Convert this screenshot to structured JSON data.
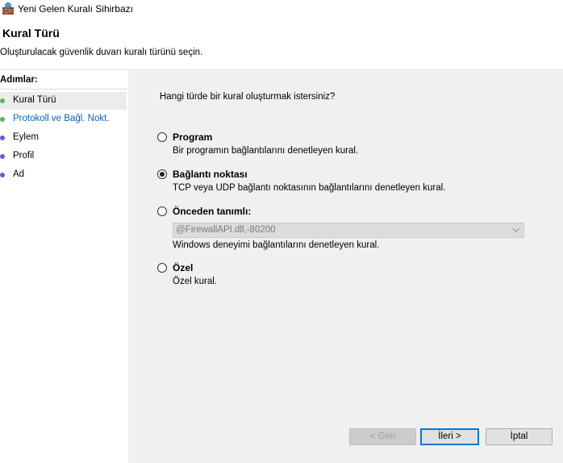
{
  "window": {
    "title": "Yeni Gelen Kuralı Sihirbazı",
    "icon": "firewall-wizard-icon"
  },
  "header": {
    "title": "Kural Türü",
    "description": "Oluşturulacak güvenlik duvarı kuralı türünü seçin."
  },
  "sidebar": {
    "heading": "Adımlar:",
    "steps": [
      {
        "label": "Kural Türü",
        "state": "current",
        "dot_color": "#5cb85c"
      },
      {
        "label": "Protokoll ve Bağl. Nokt.",
        "state": "link",
        "dot_color": "#5cb85c"
      },
      {
        "label": "Eylem",
        "state": "pending",
        "dot_color": "#6a5acd"
      },
      {
        "label": "Profil",
        "state": "pending",
        "dot_color": "#6a5acd"
      },
      {
        "label": "Ad",
        "state": "pending",
        "dot_color": "#6a5acd"
      }
    ]
  },
  "main": {
    "question": "Hangi türde bir kural oluşturmak istersiniz?",
    "options": [
      {
        "label": "Program",
        "description": "Bir programın bağlantılarını denetleyen kural.",
        "checked": false
      },
      {
        "label": "Bağlantı noktası",
        "description": "TCP veya UDP bağlantı noktasının bağlantılarını denetleyen kural.",
        "checked": true
      },
      {
        "label": "Önceden tanımlı:",
        "description": "Windows deneyimi bağlantılarını denetleyen kural.",
        "checked": false
      },
      {
        "label": "Özel",
        "description": "Özel kural.",
        "checked": false
      }
    ],
    "predefined_select": {
      "value": "@FirewallAPI.dll,-80200",
      "enabled": false
    }
  },
  "buttons": {
    "back": "< Geri",
    "next": "İleri >",
    "cancel": "İptal"
  }
}
